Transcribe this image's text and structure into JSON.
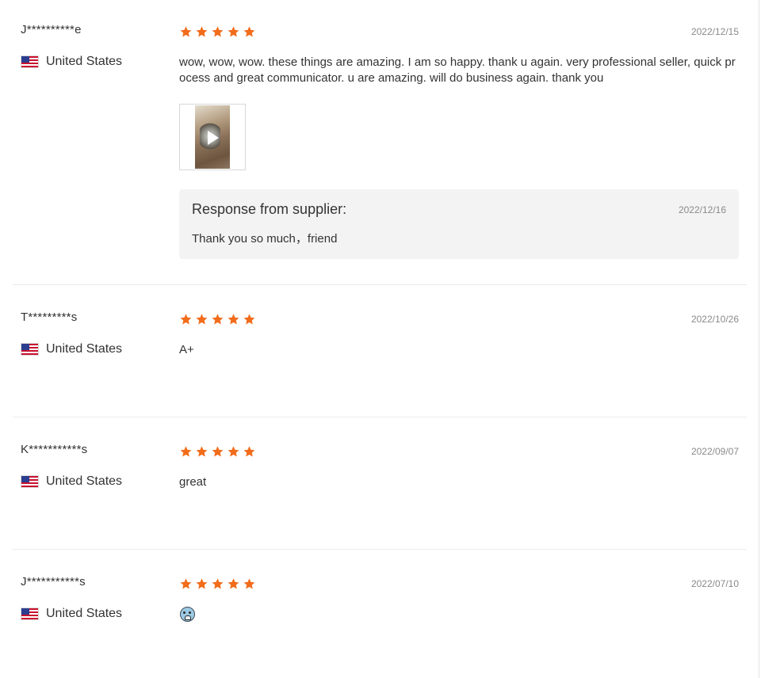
{
  "star_color": "#f26c1b",
  "reviews": [
    {
      "buyer": "J**********e",
      "country": "United States",
      "flag_icon": "us-flag-icon",
      "rating": 5,
      "date": "2022/12/15",
      "text": "wow, wow, wow. these things are amazing. I am so happy. thank u again. very professional seller, quick process and great communicator. u are amazing. will do business again. thank you",
      "media": {
        "type": "video",
        "icon": "play-icon"
      },
      "supplier_response": {
        "title": "Response from supplier:",
        "date": "2022/12/16",
        "text": "Thank you so much，friend"
      }
    },
    {
      "buyer": "T*********s",
      "country": "United States",
      "flag_icon": "us-flag-icon",
      "rating": 5,
      "date": "2022/10/26",
      "text": "A+"
    },
    {
      "buyer": "K***********s",
      "country": "United States",
      "flag_icon": "us-flag-icon",
      "rating": 5,
      "date": "2022/09/07",
      "text": "great"
    },
    {
      "buyer": "J***********s",
      "country": "United States",
      "flag_icon": "us-flag-icon",
      "rating": 5,
      "date": "2022/07/10",
      "text": "",
      "emoji_icon": "crying-face-emoji-icon"
    }
  ]
}
